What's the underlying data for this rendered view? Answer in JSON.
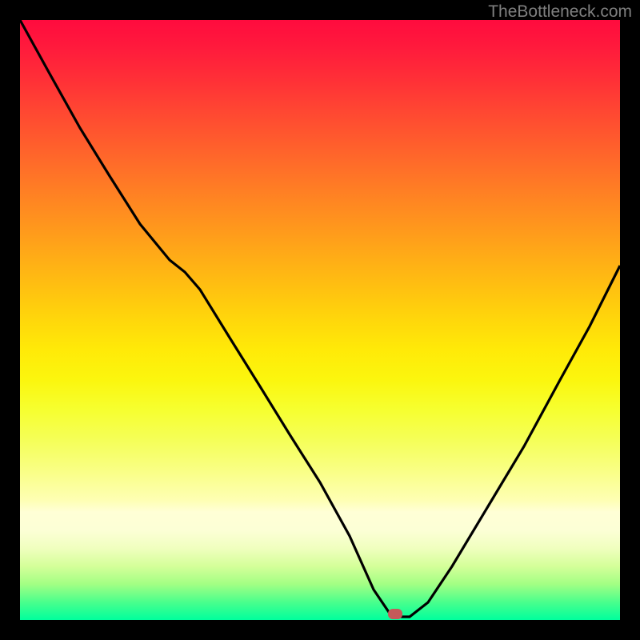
{
  "watermark": "TheBottleneck.com",
  "marker": {
    "x_frac": 0.625,
    "y_frac": 0.99
  },
  "chart_data": {
    "type": "line",
    "x": [
      0.0,
      0.05,
      0.1,
      0.15,
      0.2,
      0.25,
      0.275,
      0.3,
      0.35,
      0.4,
      0.45,
      0.5,
      0.55,
      0.59,
      0.62,
      0.65,
      0.68,
      0.72,
      0.78,
      0.84,
      0.9,
      0.95,
      1.0
    ],
    "values": [
      1.0,
      0.91,
      0.82,
      0.74,
      0.66,
      0.6,
      0.58,
      0.55,
      0.47,
      0.39,
      0.31,
      0.23,
      0.14,
      0.05,
      0.005,
      0.005,
      0.03,
      0.09,
      0.19,
      0.29,
      0.4,
      0.49,
      0.59
    ],
    "title": "",
    "xlabel": "",
    "ylabel": "",
    "xlim": [
      0,
      1
    ],
    "ylim": [
      0,
      1
    ],
    "series": [
      {
        "name": "bottleneck-curve",
        "color": "#000000"
      }
    ],
    "background": "red-yellow-green vertical gradient",
    "marker_point": {
      "x": 0.625,
      "y": 0.005,
      "color": "#c55a5a"
    }
  }
}
